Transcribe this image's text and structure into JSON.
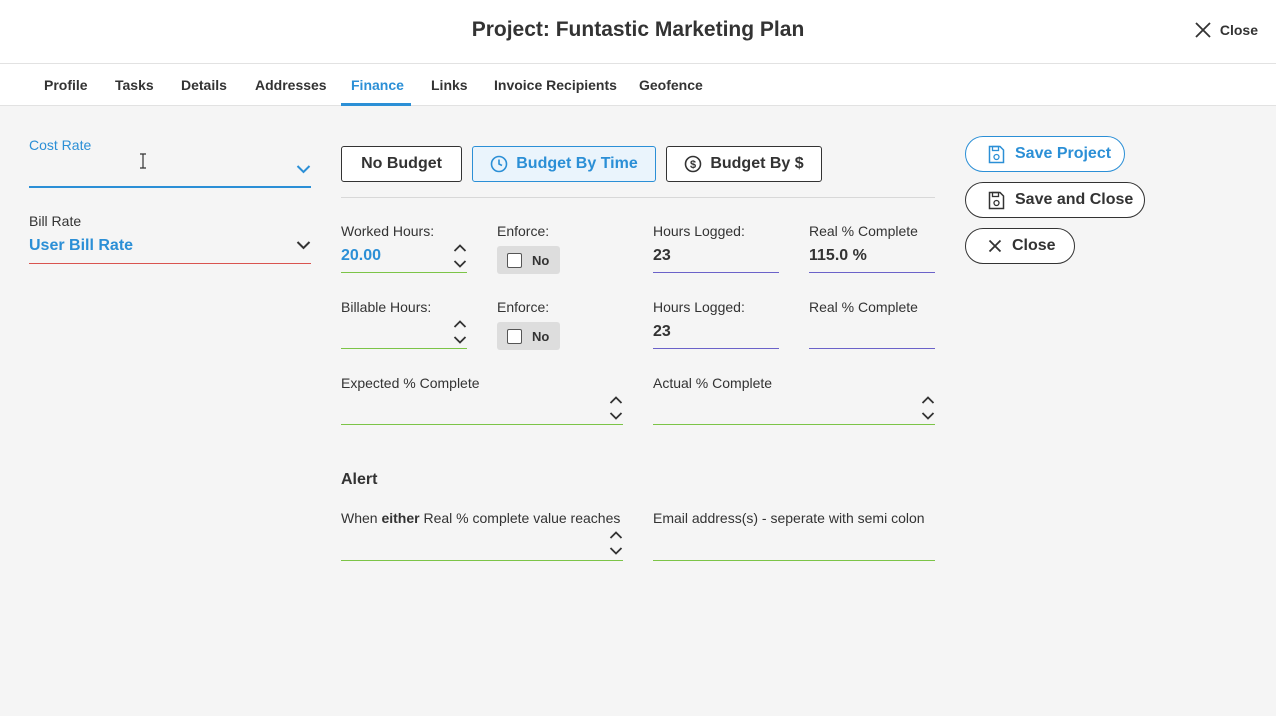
{
  "header": {
    "title": "Project: Funtastic Marketing Plan",
    "close_label": "Close"
  },
  "tabs": [
    {
      "label": "Profile"
    },
    {
      "label": "Tasks"
    },
    {
      "label": "Details"
    },
    {
      "label": "Addresses"
    },
    {
      "label": "Finance"
    },
    {
      "label": "Links"
    },
    {
      "label": "Invoice Recipients"
    },
    {
      "label": "Geofence"
    }
  ],
  "active_tab": "Finance",
  "left": {
    "cost_rate": {
      "label": "Cost Rate",
      "value": ""
    },
    "bill_rate": {
      "label": "Bill Rate",
      "value": "User Bill Rate"
    }
  },
  "budget": {
    "no_budget": "No Budget",
    "by_time": "Budget By Time",
    "by_money": "Budget By $",
    "selected": "Budget By Time"
  },
  "rows": {
    "worked": {
      "label": "Worked Hours:",
      "value": "20.00",
      "enforce_label": "Enforce:",
      "enforce_value": "No",
      "logged_label": "Hours Logged:",
      "logged_value": "23",
      "real_label": "Real % Complete",
      "real_value": "115.0 %"
    },
    "billable": {
      "label": "Billable Hours:",
      "value": "",
      "enforce_label": "Enforce:",
      "enforce_value": "No",
      "logged_label": "Hours Logged:",
      "logged_value": "23",
      "real_label": "Real % Complete",
      "real_value": ""
    }
  },
  "expected": {
    "label": "Expected % Complete",
    "value": ""
  },
  "actual": {
    "label": "Actual % Complete",
    "value": ""
  },
  "alert": {
    "title": "Alert",
    "when_prefix": "When ",
    "when_bold": "either",
    "when_suffix": " Real % complete value reaches",
    "email_label": "Email address(s) - seperate with semi colon",
    "threshold_value": "",
    "email_value": ""
  },
  "actions": {
    "save_project": "Save Project",
    "save_close": "Save and Close",
    "close": "Close"
  },
  "colors": {
    "accent": "#2b8fd6",
    "error_line": "#d9534f",
    "valid_line": "#7cc447",
    "readonly_line": "#6b62c9"
  }
}
